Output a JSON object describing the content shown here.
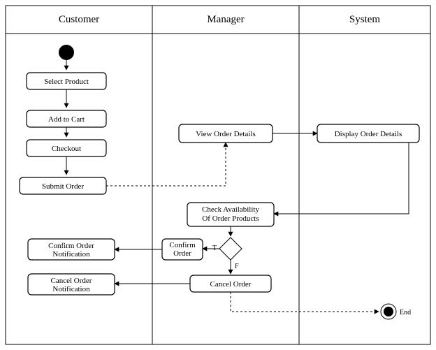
{
  "lanes": {
    "customer": "Customer",
    "manager": "Manager",
    "system": "System"
  },
  "activities": {
    "select_product": "Select Product",
    "add_to_cart": "Add to Cart",
    "checkout": "Checkout",
    "submit_order": "Submit Order",
    "confirm_order_notification": "Confirm Order\nNotification",
    "cancel_order_notification": "Cancel Order\nNotification",
    "view_order_details": "View Order Details",
    "check_availability": "Check Availability\nOf Order Products",
    "confirm_order": "Confirm\nOrder",
    "cancel_order": "Cancel Order",
    "display_order_details": "Display Order Details"
  },
  "decision": {
    "true_label": "T",
    "false_label": "F"
  },
  "end_label": "End"
}
